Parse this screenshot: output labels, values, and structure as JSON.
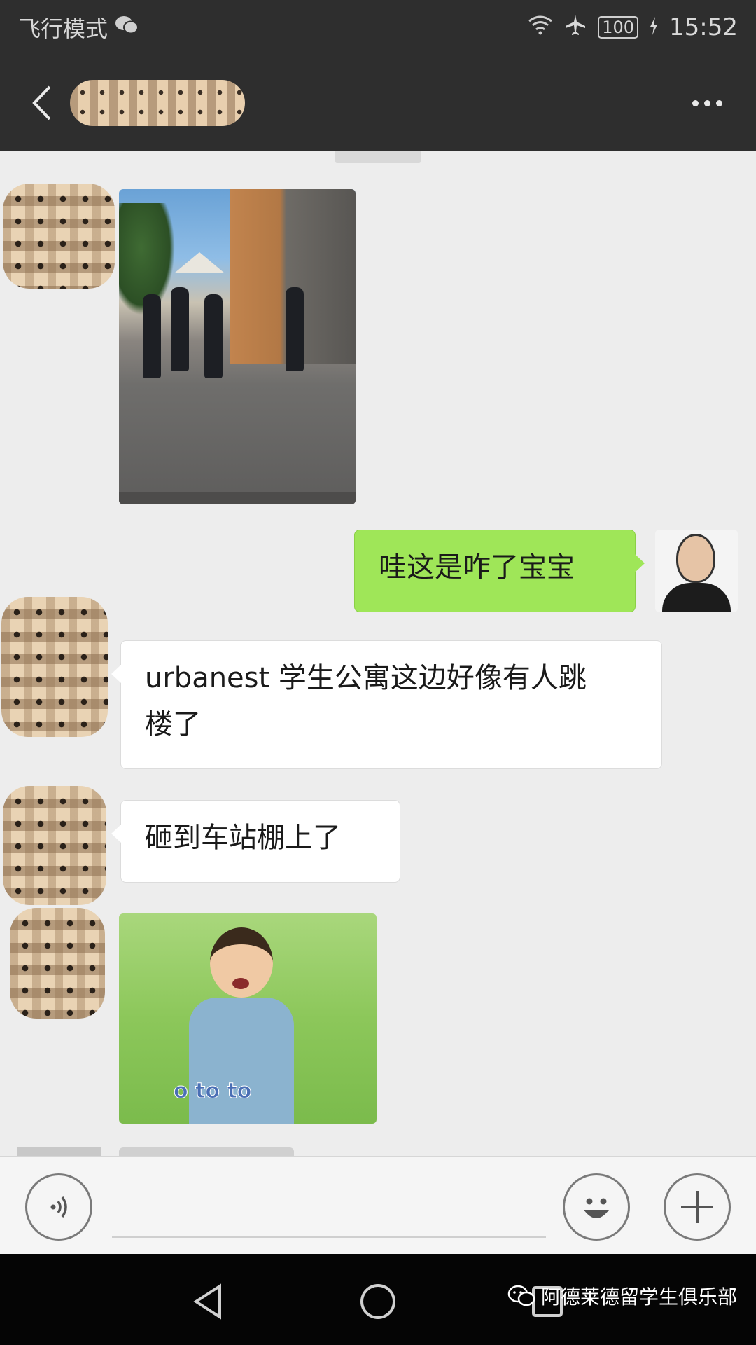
{
  "status_bar": {
    "mode_label": "飞行模式",
    "battery": "100",
    "time": "15:52"
  },
  "title_bar": {
    "contact_name_blurred": true
  },
  "messages": [
    {
      "sender": "other",
      "type": "image",
      "content": "street-police-photo"
    },
    {
      "sender": "me",
      "type": "text",
      "text": "哇这是咋了宝宝"
    },
    {
      "sender": "other",
      "type": "text",
      "text_line1": "urbanest 学生公寓这边好像有人跳",
      "text_line2": "楼了"
    },
    {
      "sender": "other",
      "type": "text",
      "text": "砸到车站棚上了"
    },
    {
      "sender": "other",
      "type": "image",
      "content": "crying-boy-sticker",
      "caption": "o to to"
    }
  ],
  "input_bar": {
    "voice_icon": "voice-icon",
    "emoji_icon": "emoji-icon",
    "plus_icon": "plus-icon"
  },
  "nav_bar": {
    "watermark": "阿德莱德留学生俱乐部"
  },
  "colors": {
    "header_bg": "#2e2e2e",
    "chat_bg": "#ededed",
    "green_bubble": "#9fe658",
    "white_bubble": "#ffffff"
  }
}
